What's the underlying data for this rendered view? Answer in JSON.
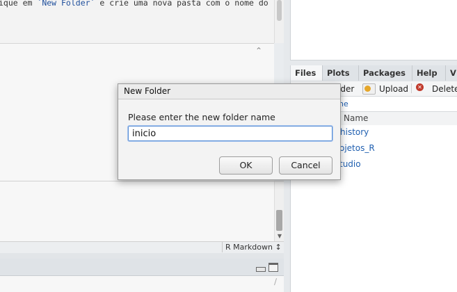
{
  "editor": {
    "line_prefix": "ique em ",
    "line_code": "`New Folder`",
    "line_suffix": " e crie uma nova pasta com o nome do"
  },
  "icons": {
    "collapse": "double-chevron-up",
    "scroll_down": "arrow-down",
    "minimize": "minimize-pane",
    "maximize": "maximize-pane",
    "broom": "clear-console",
    "upload": "upload",
    "delete": "delete"
  },
  "status_bar": {
    "doc_type": "R Markdown ↕"
  },
  "right_pane": {
    "tabs": [
      "Files",
      "Plots",
      "Packages",
      "Help",
      "V"
    ],
    "toolbar": {
      "new_folder_fragment": "lder",
      "upload_label": "Upload",
      "delete_label": "Delete"
    },
    "path_fragment": "ne",
    "table_header_name": "Name",
    "files": [
      "history",
      "ojetos_R",
      "tudio"
    ]
  },
  "dialog": {
    "title": "New Folder",
    "prompt": "Please enter the new folder name",
    "input_value": "inicio",
    "ok_label": "OK",
    "cancel_label": "Cancel"
  },
  "colors": {
    "link": "#1f5fb0",
    "input_focus": "#5b8fd6",
    "delete_icon": "#c0392b",
    "upload_icon": "#e5a62a"
  }
}
